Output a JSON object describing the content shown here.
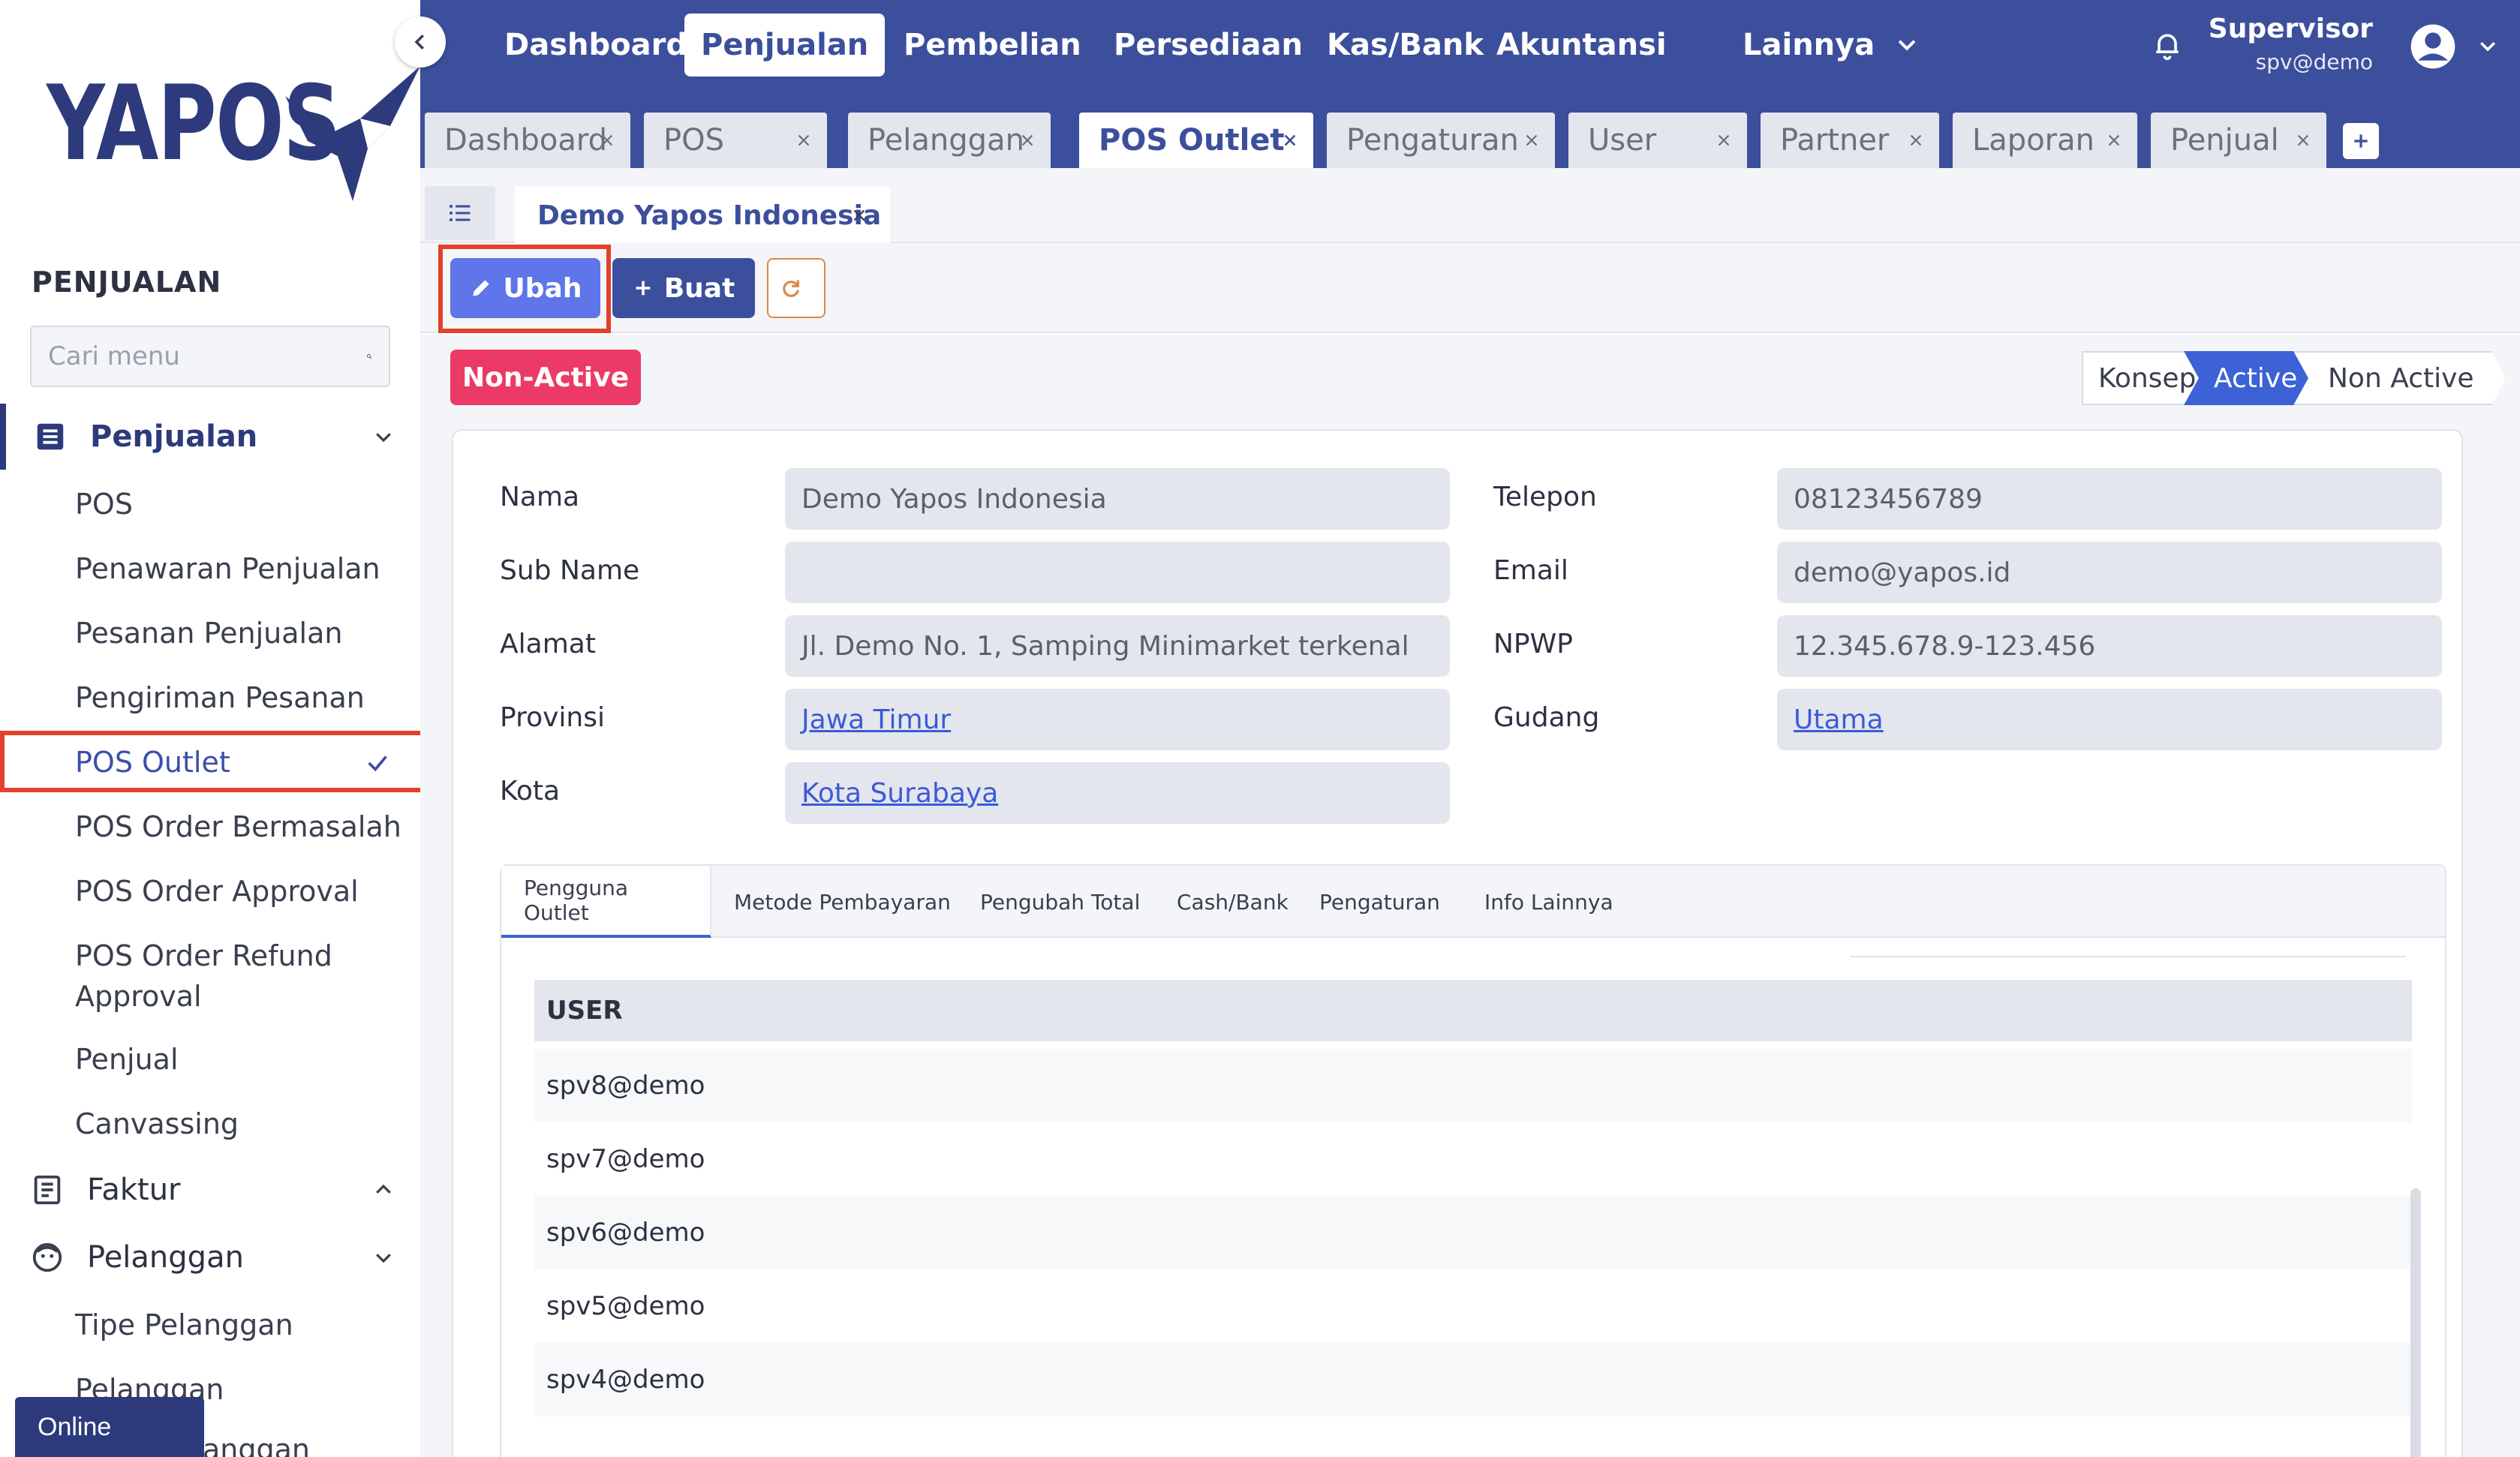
{
  "brand": {
    "logo_text": "YAPOS"
  },
  "sidebar": {
    "section_title": "PENJUALAN",
    "search_placeholder": "Cari menu",
    "groups": {
      "penjualan": "Penjualan",
      "faktur": "Faktur",
      "pelanggan": "Pelanggan"
    },
    "penjualan_items": [
      "POS",
      "Penawaran Penjualan",
      "Pesanan Penjualan",
      "Pengiriman Pesanan",
      "POS Outlet",
      "POS Order Bermasalah",
      "POS Order Approval",
      "POS Order Refund",
      "Approval",
      "Penjual",
      "Canvassing"
    ],
    "pelanggan_items": [
      "Tipe Pelanggan",
      "Pelanggan",
      "anggan"
    ],
    "online_label": "Online"
  },
  "topnav": {
    "items": [
      "Dashboard",
      "Penjualan",
      "Pembelian",
      "Persediaan",
      "Kas/Bank",
      "Akuntansi",
      "Lainnya"
    ],
    "active": "Penjualan",
    "user_name": "Supervisor",
    "user_email": "spv@demo"
  },
  "tabs": {
    "items": [
      "Dashboard",
      "POS",
      "Pelanggan",
      "POS Outlet",
      "Pengaturan",
      "User",
      "Partner",
      "Laporan",
      "Penjual"
    ],
    "active": "POS Outlet"
  },
  "doc_tab": {
    "label": "Demo Yapos Indonesia"
  },
  "toolbar": {
    "edit_label": "Ubah",
    "create_label": "Buat"
  },
  "status": {
    "badge": "Non-Active",
    "steps": [
      "Konsep",
      "Active",
      "Non Active"
    ],
    "active_step": "Active"
  },
  "form": {
    "nama": {
      "label": "Nama",
      "value": "Demo Yapos Indonesia"
    },
    "sub_name": {
      "label": "Sub Name",
      "value": ""
    },
    "alamat": {
      "label": "Alamat",
      "value": "Jl. Demo No. 1, Samping Minimarket terkenal"
    },
    "provinsi": {
      "label": "Provinsi",
      "value": "Jawa Timur"
    },
    "kota": {
      "label": "Kota",
      "value": "Kota Surabaya"
    },
    "telepon": {
      "label": "Telepon",
      "value": "08123456789"
    },
    "email": {
      "label": "Email",
      "value": "demo@yapos.id"
    },
    "npwp": {
      "label": "NPWP",
      "value": "12.345.678.9-123.456"
    },
    "gudang": {
      "label": "Gudang",
      "value": "Utama"
    }
  },
  "detail_tabs": {
    "items": [
      "Pengguna Outlet",
      "Metode Pembayaran",
      "Pengubah Total",
      "Cash/Bank",
      "Pengaturan",
      "Info Lainnya"
    ],
    "active": "Pengguna Outlet"
  },
  "user_table": {
    "header": "USER",
    "rows": [
      "spv8@demo",
      "spv7@demo",
      "spv6@demo",
      "spv5@demo",
      "spv4@demo"
    ]
  },
  "colors": {
    "primary": "#3c4f9c",
    "accent": "#5f75ea",
    "danger": "#ec3a66",
    "highlight": "#e2412b"
  }
}
